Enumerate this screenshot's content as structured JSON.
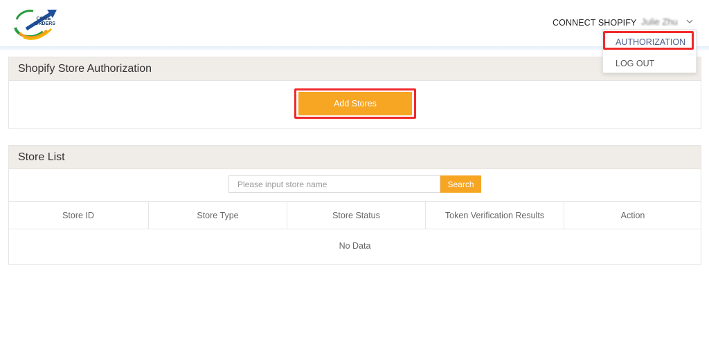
{
  "header": {
    "logo_text_top": "COME",
    "logo_text_bottom": "ORDERS",
    "connect_label": "CONNECT SHOPIFY",
    "user_name": "Julie Zhu"
  },
  "dropdown": {
    "items": [
      {
        "label": "AUTHORIZATION"
      },
      {
        "label": "LOG OUT"
      }
    ]
  },
  "auth_panel": {
    "title": "Shopify Store Authorization",
    "add_button": "Add Stores"
  },
  "store_panel": {
    "title": "Store List",
    "search_placeholder": "Please input store name",
    "search_button": "Search",
    "columns": [
      "Store ID",
      "Store Type",
      "Store Status",
      "Token Verification Results",
      "Action"
    ],
    "empty_text": "No Data"
  },
  "colors": {
    "accent_orange": "#f6a623",
    "highlight_red": "#f0292a",
    "panel_header": "#f0ece8"
  }
}
